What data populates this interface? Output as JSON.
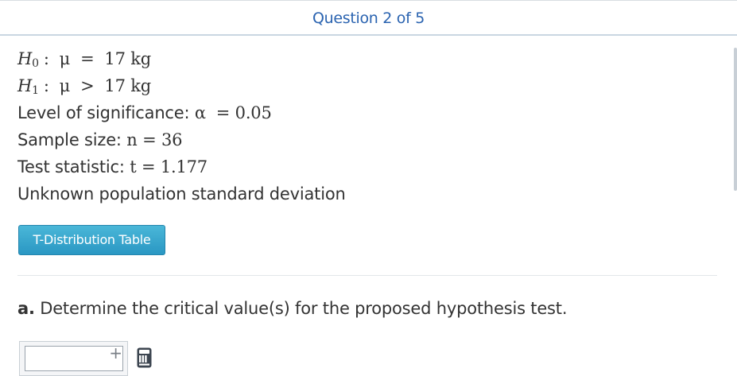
{
  "header": {
    "title": "Question 2 of 5"
  },
  "hypotheses": {
    "h0": {
      "symbol": "H",
      "sub": "0",
      "relation": ":  μ  =  17 kg"
    },
    "h1": {
      "symbol": "H",
      "sub": "1",
      "relation": ":  μ  >  17 kg"
    }
  },
  "given": {
    "significance_label": "Level of significance:",
    "significance_value": "α  = 0.05",
    "sample_label": "Sample size:",
    "sample_value": "n = 36",
    "statistic_label": "Test statistic:",
    "statistic_value": "t = 1.177",
    "note": "Unknown population standard deviation"
  },
  "table_button": {
    "label": "T-Distribution Table"
  },
  "part_a": {
    "letter": "a.",
    "prompt": "Determine the critical value(s) for the proposed hypothesis test."
  },
  "answer": {
    "value": "",
    "plus_symbol": "+"
  },
  "icons": {
    "add": "plus-icon",
    "calculator": "calculator-icon"
  },
  "colors": {
    "header_title": "#2a63b0",
    "button": "#2a97c3",
    "text": "#333333"
  }
}
